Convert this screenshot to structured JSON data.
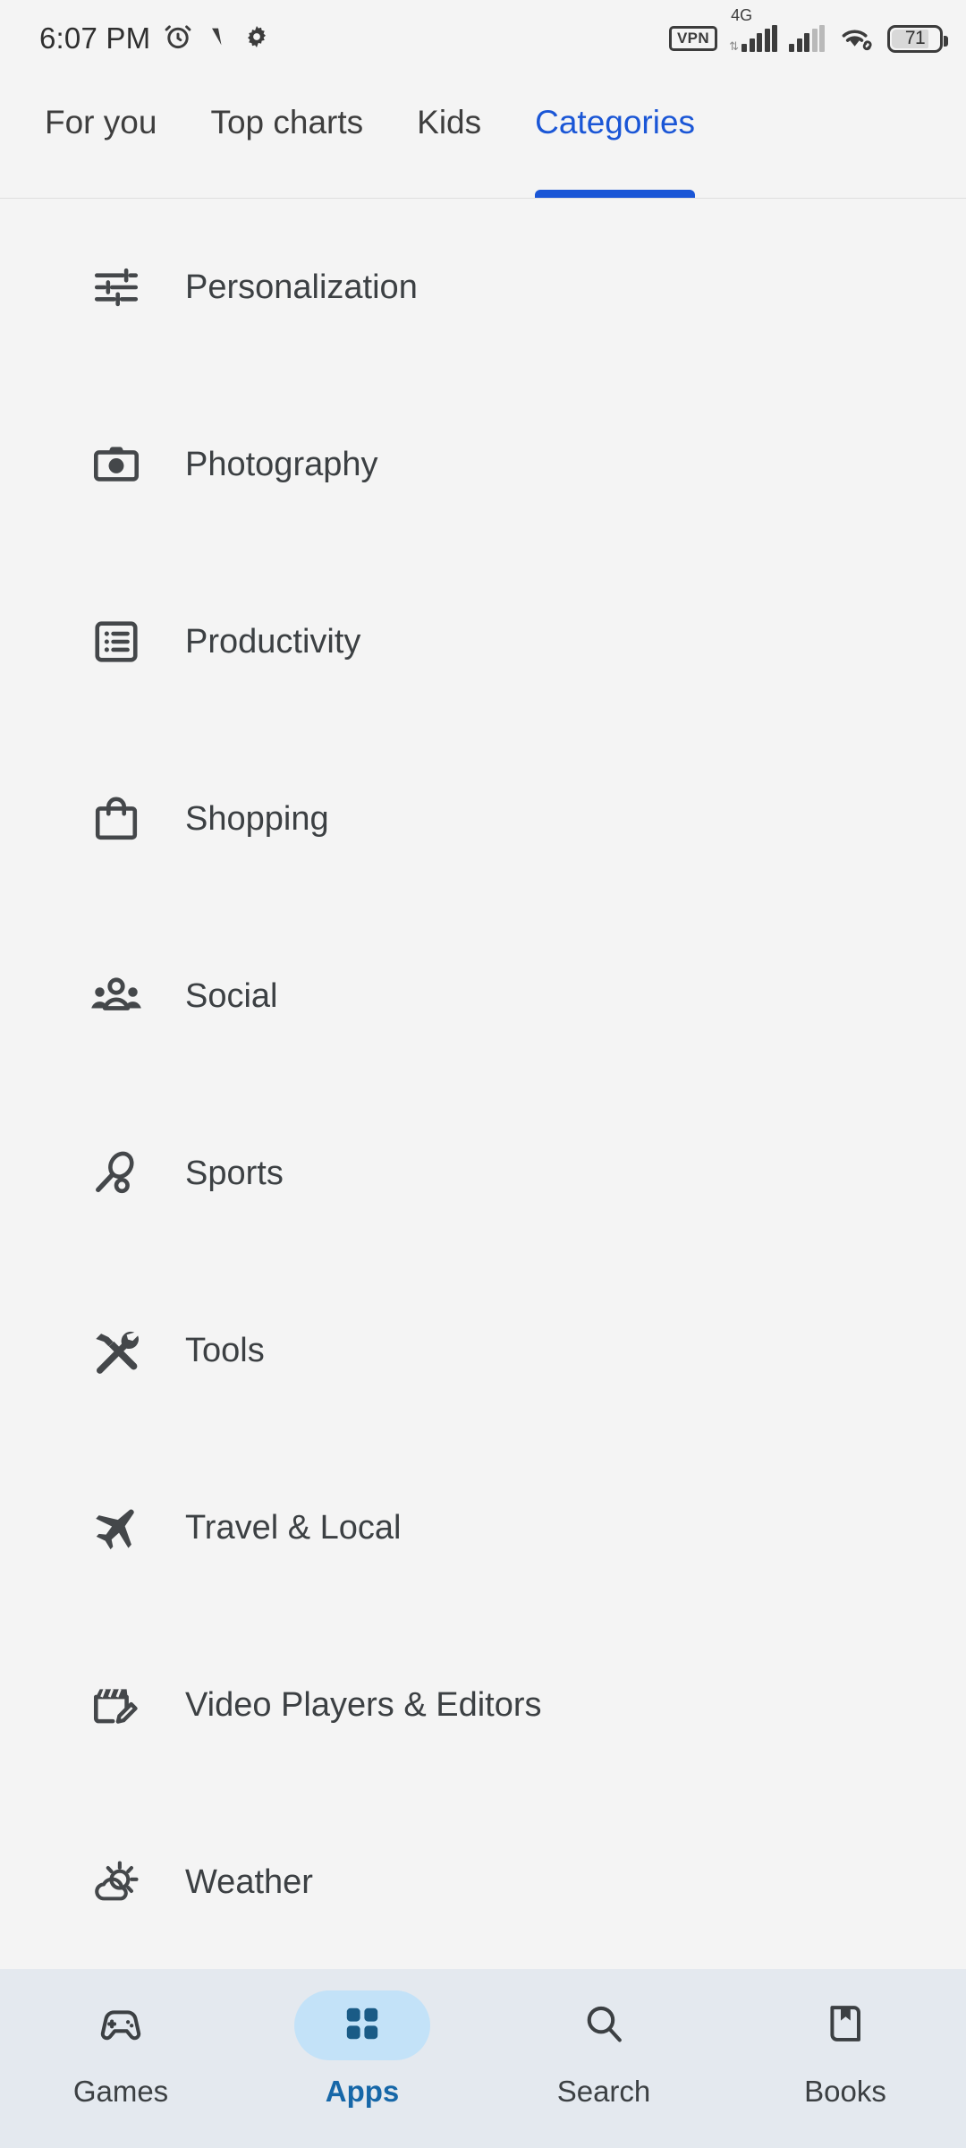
{
  "status_bar": {
    "time": "6:07 PM",
    "left_icons": [
      "alarm-icon",
      "vibrate-icon",
      "gear-icon"
    ],
    "vpn_label": "VPN",
    "network_type": "4G",
    "signal_bars_1": [
      30,
      55,
      70,
      85,
      100
    ],
    "signal_bars_2": [
      30,
      55,
      70,
      100
    ],
    "signal2_dim_from": 3,
    "wifi": "wifi-link-icon",
    "battery_percent": "71"
  },
  "tabs": {
    "items": [
      {
        "label": "For you",
        "active": false
      },
      {
        "label": "Top charts",
        "active": false
      },
      {
        "label": "Kids",
        "active": false
      },
      {
        "label": "Categories",
        "active": true
      }
    ],
    "active_color": "#1a56d6",
    "inactive_color": "#3e3e3e"
  },
  "categories": {
    "items": [
      {
        "label": "Personalization",
        "icon": "tune-sliders-icon"
      },
      {
        "label": "Photography",
        "icon": "camera-icon"
      },
      {
        "label": "Productivity",
        "icon": "list-box-icon"
      },
      {
        "label": "Shopping",
        "icon": "shopping-bag-icon"
      },
      {
        "label": "Social",
        "icon": "people-group-icon"
      },
      {
        "label": "Sports",
        "icon": "tennis-racquet-icon"
      },
      {
        "label": "Tools",
        "icon": "hammer-wrench-icon"
      },
      {
        "label": "Travel & Local",
        "icon": "airplane-icon"
      },
      {
        "label": "Video Players & Editors",
        "icon": "clapperboard-pencil-icon"
      },
      {
        "label": "Weather",
        "icon": "sun-cloud-icon"
      }
    ],
    "text_color": "#3c4043",
    "icon_color": "#44474a"
  },
  "bottom_nav": {
    "items": [
      {
        "label": "Games",
        "icon": "gamepad-icon",
        "active": false
      },
      {
        "label": "Apps",
        "icon": "apps-grid-icon",
        "active": true
      },
      {
        "label": "Search",
        "icon": "search-icon",
        "active": false
      },
      {
        "label": "Books",
        "icon": "book-bookmark-icon",
        "active": false
      }
    ],
    "background": "#e4e9ef",
    "active_pill_color": "#c3e2f8",
    "active_icon_color": "#1a5b86",
    "active_label_color": "#1667a8",
    "inactive_color": "#3c4043"
  }
}
